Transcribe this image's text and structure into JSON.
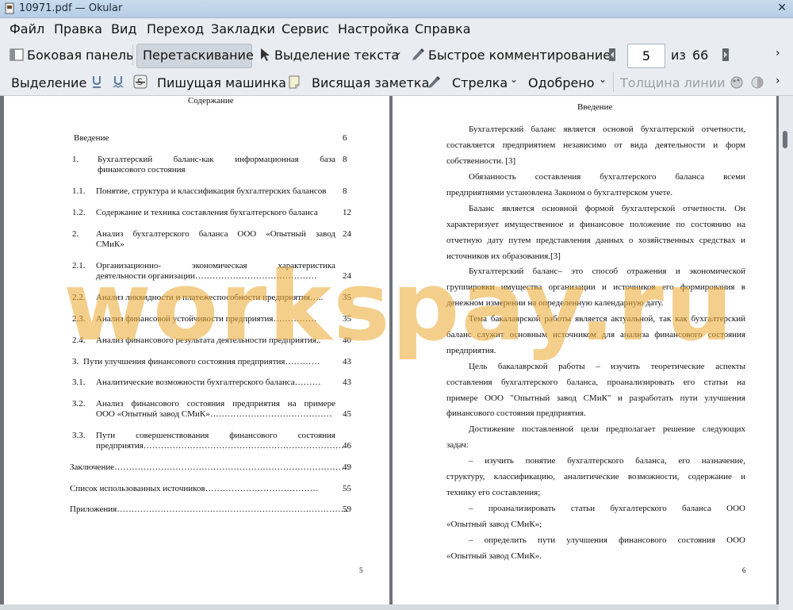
{
  "window": {
    "title": "10971.pdf  — Okular"
  },
  "menu": [
    "Файл",
    "Правка",
    "Вид",
    "Переход",
    "Закладки",
    "Сервис",
    "Настройка",
    "Справка"
  ],
  "toolbar1": {
    "sidebar": "Боковая панель",
    "drag": "Перетаскивание",
    "text_select": "Выделение текста",
    "quick_comment": "Быстрое комментирование",
    "page_current": "5",
    "page_of": "из",
    "page_total": "66"
  },
  "toolbar2": {
    "highlight": "Выделение",
    "typewriter": "Пишущая машинка",
    "note": "Висящая заметка",
    "arrow": "Стрелка",
    "stamp": "Одобрено",
    "line_width": "Толщина линии"
  },
  "watermark": "workspay.ru",
  "page_left": {
    "title": "Содержание",
    "page_number": "5",
    "toc": [
      {
        "num": "",
        "text": "Введение",
        "page": "6"
      },
      {
        "num": "1.",
        "text": "Бухгалтерский баланс-как информационная база",
        "text2": "финансового состояния",
        "page": "8"
      },
      {
        "num": "1.1.",
        "text": "Понятие, структура и классификация бухгалтерских балансов",
        "page": "8"
      },
      {
        "num": "1.2.",
        "text": "Содержание и техника составления бухгалтерского баланса",
        "page": "12"
      },
      {
        "num": "2.",
        "text": "Анализ бухгалтерского баланса ООО «Опытный завод",
        "text2": "СМиК»",
        "page": "24"
      },
      {
        "num": "2.1.",
        "text": "Организационно- экономическая характеристика",
        "text2": "деятельности организации……………………………………",
        "page": "24"
      },
      {
        "num": "2.2.",
        "text": "Анализ ликвидности и платежеспособности предприятия…..",
        "page": "35"
      },
      {
        "num": "2.3.",
        "text": "Анализ финансовой устойчивости предприятия……………",
        "page": "35"
      },
      {
        "num": "2.4.",
        "text": "Анализ финансового результата деятельности предприятия..",
        "page": "40"
      },
      {
        "num": "3.",
        "text": "Пути улучшения финансового состояния предприятия…………",
        "page": "43"
      },
      {
        "num": "3.1.",
        "text": "Аналитические возможности бухгалтерского баланса………",
        "page": "43"
      },
      {
        "num": "3.2.",
        "text": "Анализ финансового состояния предприятия на примере",
        "text2": "ООО «Опытный завод СМиК»……………………………………",
        "page": "45"
      },
      {
        "num": "3.3.",
        "text": "Пути совершенствования финансового состояния",
        "text2": "предприятия……………………………………………………………",
        "page": "46"
      },
      {
        "num": "",
        "text": "Заключение………………………………………………………………………",
        "page": "49"
      },
      {
        "num": "",
        "text": "Список использованных источников…………………………………",
        "page": "55"
      },
      {
        "num": "",
        "text": "Приложения……………………………………………………………………..",
        "page": "59"
      }
    ]
  },
  "page_right": {
    "title": "Введение",
    "page_number": "6",
    "lines": [
      "Бухгалтерский баланс является основой бухгалтерской отчетности,",
      "составляется предприятием независимо от вида деятельности и форм",
      "собственности. [3]",
      "Обязанность составления бухгалтерского баланса всеми",
      "предприятиями установлена Законом о бухгалтерском учете.",
      "Баланс является основной формой бухгалтерской отчетности. Он",
      "характеризует имущественное и финансовое положение по состоянию на",
      "отчетную дату путем представления данных о хозяйственных средствах и",
      "источников их образования.[3]",
      "Бухгалтерский баланс– это способ отражения и экономической",
      "группировки имущества организации и источников его формирования в",
      "денежном измерении на определенную календарную дату.",
      "Тема бакалаврской работы является актуальной, так как бухгалтерский",
      "баланс служит основным источником для анализа финансового состояния",
      "предприятия.",
      "Цель бакалаврской работы – изучить теоретические аспекты",
      "составления бухгалтерского баланса, проанализировать его статьи на",
      "примере ООО \"Опытный завод СМиК\" и разработать пути улучшения",
      "финансового состояния предприятия.",
      "Достижение поставленной цели предполагает решение следующих",
      "задач:",
      "– изучить понятие бухгалтерского баланса, его назначение,",
      "структуру, классификацию, аналитические возможности, содержание и",
      "технику его составления;",
      "– проанализировать статьи бухгалтерского баланса ООО",
      "«Опытный завод СМиК»;",
      "– определить пути улучшения финансового состояния ООО",
      "«Опытный завод СМиК»."
    ]
  }
}
